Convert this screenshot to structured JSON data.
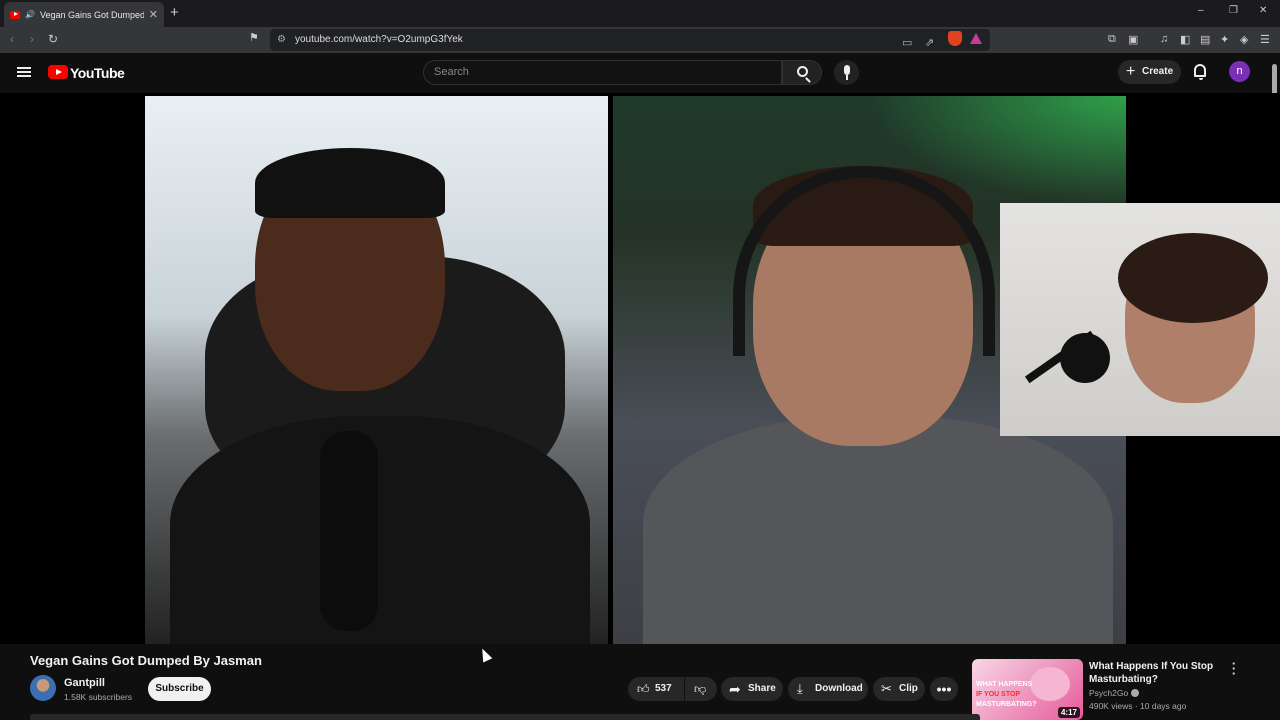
{
  "browser": {
    "tab_title": "Vegan Gains Got Dumped By",
    "new_tab": "+",
    "close_tab": "✕",
    "url": "youtube.com/watch?v=O2umpG3fYek",
    "window_minimize": "–",
    "window_restore": "❐",
    "window_close": "✕"
  },
  "youtube": {
    "logo_text": "YouTube",
    "search_placeholder": "Search",
    "create_label": "Create",
    "avatar_letter": "n"
  },
  "video": {
    "title": "Vegan Gains Got Dumped By Jasman",
    "channel_name": "Gantpill",
    "subscribers": "1.58K subscribers",
    "subscribe_label": "Subscribe",
    "likes": "537",
    "share_label": "Share",
    "download_label": "Download",
    "clip_label": "Clip"
  },
  "recommended": [
    {
      "title": "What Happens If You Stop Masturbating?",
      "channel": "Psych2Go",
      "meta": "490K views · 10 days ago",
      "duration": "4:17",
      "thumb_line1": "WHAT HAPPENS",
      "thumb_line2": "IF YOU STOP",
      "thumb_line3": "MASTURBATING?"
    }
  ],
  "colors": {
    "youtube_red": "#ff0000",
    "avatar_purple": "#7b2fb7",
    "background": "#0f0f0f"
  },
  "icons": [
    "hamburger-icon",
    "youtube-logo-icon",
    "search-icon",
    "mic-icon",
    "plus-icon",
    "bell-icon",
    "like-icon",
    "dislike-icon",
    "share-icon",
    "download-icon",
    "clip-icon",
    "more-icon",
    "verified-icon"
  ]
}
